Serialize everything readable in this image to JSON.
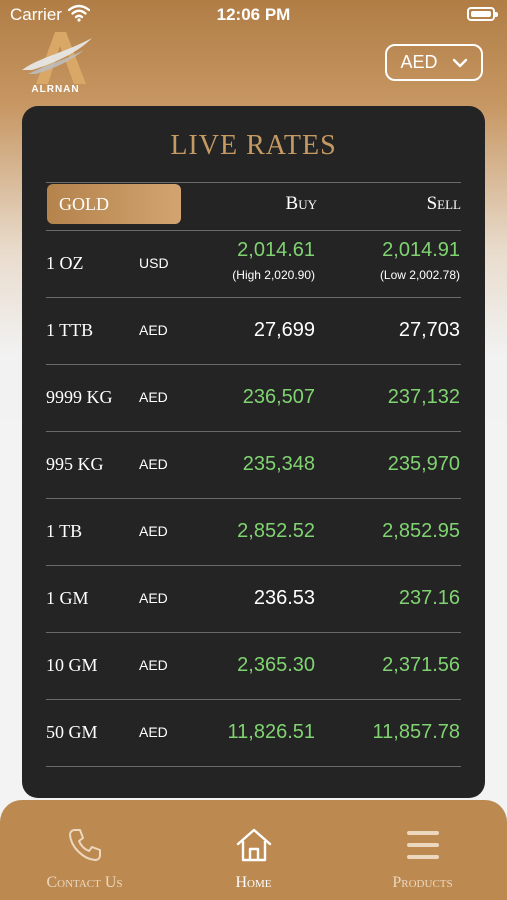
{
  "status_bar": {
    "carrier": "Carrier",
    "time": "12:06 PM"
  },
  "logo": {
    "brand": "ALRNAN"
  },
  "currency_selector": {
    "value": "AED"
  },
  "card": {
    "title": "LIVE RATES"
  },
  "table": {
    "tab_label": "GOLD",
    "buy_header": "Buy",
    "sell_header": "Sell",
    "rows": [
      {
        "name": "1 OZ",
        "currency": "USD",
        "buy": "2,014.61",
        "sell": "2,014.91",
        "buy_sub": "(High 2,020.90)",
        "sell_sub": "(Low 2,002.78)"
      },
      {
        "name": "1 TTB",
        "currency": "AED",
        "buy": "27,699",
        "sell": "27,703"
      },
      {
        "name": "9999 KG",
        "currency": "AED",
        "buy": "236,507",
        "sell": "237,132"
      },
      {
        "name": "995 KG",
        "currency": "AED",
        "buy": "235,348",
        "sell": "235,970"
      },
      {
        "name": "1 TB",
        "currency": "AED",
        "buy": "2,852.52",
        "sell": "2,852.95"
      },
      {
        "name": "1 GM",
        "currency": "AED",
        "buy": "236.53",
        "sell": "237.16"
      },
      {
        "name": "10 GM",
        "currency": "AED",
        "buy": "2,365.30",
        "sell": "2,371.56"
      },
      {
        "name": "50 GM",
        "currency": "AED",
        "buy": "11,826.51",
        "sell": "11,857.78"
      }
    ]
  },
  "nav": {
    "contact": "Contact Us",
    "home": "Home",
    "products": "Products"
  },
  "colors": {
    "accent": "#c59a62",
    "up": "#80d371",
    "card_bg": "#242424",
    "nav_bg": "#bc8a51"
  }
}
